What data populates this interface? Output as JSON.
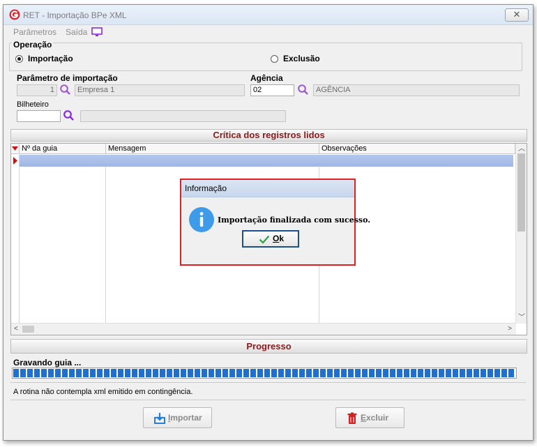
{
  "window": {
    "title": "RET - Importação BPe XML",
    "close_symbol": "✕"
  },
  "menu": {
    "items": [
      {
        "label": "Parâmetros"
      },
      {
        "label": "Saída"
      }
    ]
  },
  "operation": {
    "legend": "Operação",
    "options": [
      {
        "label": "Importação",
        "checked": true
      },
      {
        "label": "Exclusão",
        "checked": false
      }
    ]
  },
  "import_param": {
    "label": "Parâmetro de importação",
    "code": "1",
    "name": "Empresa 1"
  },
  "agency": {
    "label": "Agência",
    "code": "02",
    "name": "AGÊNCIA"
  },
  "ticket_agent": {
    "label": "Bilheteiro",
    "code": "",
    "name": ""
  },
  "records": {
    "title": "Crítica dos registros lidos",
    "columns": [
      "Nº da guia",
      "Mensagem",
      "Observações"
    ]
  },
  "dialog": {
    "title": "Informação",
    "message": "Importação finalizada com sucesso.",
    "ok_prefix": "O",
    "ok_rest": "k",
    "icon": "info-icon"
  },
  "progress": {
    "title": "Progresso",
    "status": "Gravando guia ...",
    "percent": 100
  },
  "note": "A rotina não contempla xml emitido em contingência.",
  "buttons": {
    "import_prefix": "I",
    "import_rest": "mportar",
    "delete_prefix": "E",
    "delete_rest": "xcluir"
  },
  "colors": {
    "accent": "#8b1a1a",
    "selection": "#a0b6e4",
    "progress": "#1e6fcf",
    "dialog_border": "#e02020"
  }
}
